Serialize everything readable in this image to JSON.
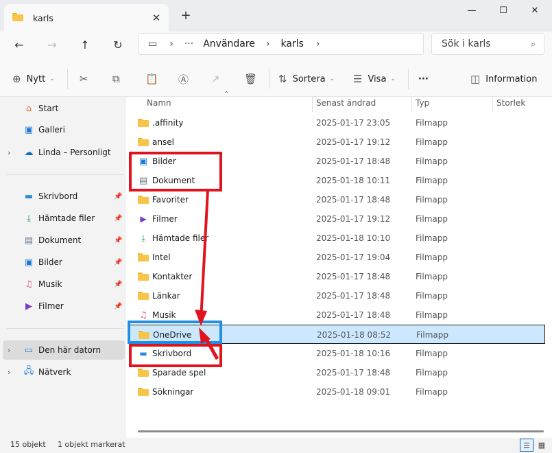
{
  "window": {
    "tab_title": "karls",
    "tab_close": "✕",
    "new_tab": "+",
    "minimize": "—",
    "maximize": "☐",
    "close": "✕"
  },
  "nav": {
    "back": "←",
    "forward": "→",
    "up": "↑",
    "refresh": "↻",
    "breadcrumb": {
      "computer_icon": "▭",
      "sep": "›",
      "ellipsis": "···",
      "items": [
        "Användare",
        "karls"
      ]
    },
    "search_placeholder": "Sök i karls",
    "search_icon": "⌕"
  },
  "commands": {
    "new_label": "Nytt",
    "sort_label": "Sortera",
    "view_label": "Visa",
    "more": "···",
    "info_label": "Information"
  },
  "sidebar": {
    "top": [
      {
        "label": "Start",
        "icon": "home-icon"
      },
      {
        "label": "Galleri",
        "icon": "gallery-icon"
      },
      {
        "label": "Linda – Personligt",
        "icon": "cloud-icon"
      }
    ],
    "pinned": [
      {
        "label": "Skrivbord",
        "icon": "desktop-icon"
      },
      {
        "label": "Hämtade filer",
        "icon": "download-icon"
      },
      {
        "label": "Dokument",
        "icon": "document-icon"
      },
      {
        "label": "Bilder",
        "icon": "pictures-icon"
      },
      {
        "label": "Musik",
        "icon": "music-icon"
      },
      {
        "label": "Filmer",
        "icon": "videos-icon"
      }
    ],
    "bottom": [
      {
        "label": "Den här datorn",
        "icon": "pc-icon"
      },
      {
        "label": "Nätverk",
        "icon": "network-icon"
      }
    ]
  },
  "columns": {
    "name": "Namn",
    "modified": "Senast ändrad",
    "type": "Typ",
    "size": "Storlek"
  },
  "files": [
    {
      "name": ".affinity",
      "date": "2025-01-17 23:05",
      "type": "Filmapp",
      "icon": "folder"
    },
    {
      "name": "ansel",
      "date": "2025-01-17 19:12",
      "type": "Filmapp",
      "icon": "folder"
    },
    {
      "name": "Bilder",
      "date": "2025-01-17 18:48",
      "type": "Filmapp",
      "icon": "pictures"
    },
    {
      "name": "Dokument",
      "date": "2025-01-18 10:11",
      "type": "Filmapp",
      "icon": "document"
    },
    {
      "name": "Favoriter",
      "date": "2025-01-17 18:48",
      "type": "Filmapp",
      "icon": "folder"
    },
    {
      "name": "Filmer",
      "date": "2025-01-17 19:12",
      "type": "Filmapp",
      "icon": "videos"
    },
    {
      "name": "Hämtade filer",
      "date": "2025-01-18 10:10",
      "type": "Filmapp",
      "icon": "download"
    },
    {
      "name": "Intel",
      "date": "2025-01-17 19:04",
      "type": "Filmapp",
      "icon": "folder"
    },
    {
      "name": "Kontakter",
      "date": "2025-01-17 18:48",
      "type": "Filmapp",
      "icon": "folder"
    },
    {
      "name": "Länkar",
      "date": "2025-01-17 18:48",
      "type": "Filmapp",
      "icon": "folder"
    },
    {
      "name": "Musik",
      "date": "2025-01-17 18:48",
      "type": "Filmapp",
      "icon": "music"
    },
    {
      "name": "OneDrive",
      "date": "2025-01-18 08:52",
      "type": "Filmapp",
      "icon": "folder",
      "selected": true
    },
    {
      "name": "Skrivbord",
      "date": "2025-01-18 10:16",
      "type": "Filmapp",
      "icon": "desktop"
    },
    {
      "name": "Sparade spel",
      "date": "2025-01-17 18:48",
      "type": "Filmapp",
      "icon": "folder"
    },
    {
      "name": "Sökningar",
      "date": "2025-01-18 09:01",
      "type": "Filmapp",
      "icon": "folder"
    }
  ],
  "status": {
    "count": "15 objekt",
    "selected": "1 objekt markerat"
  },
  "colors": {
    "accent": "#0067c0",
    "selection": "#cce8ff",
    "annotation_red": "#e0141e",
    "annotation_blue": "#1e8fe6",
    "folder": "#f8c44a"
  }
}
